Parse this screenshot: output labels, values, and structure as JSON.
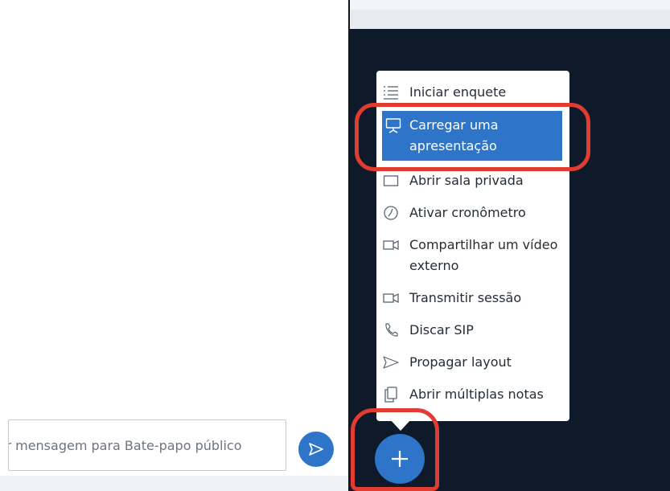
{
  "chat": {
    "input_placeholder": "ir mensagem para Bate-papo público",
    "send_icon": "send-icon"
  },
  "actions_menu": {
    "items": [
      {
        "label": "Iniciar enquete",
        "icon": "poll-list-icon",
        "highlighted": false
      },
      {
        "label": "Carregar uma apresentação",
        "icon": "presentation-icon",
        "highlighted": true
      },
      {
        "label": "Abrir sala privada",
        "icon": "breakout-room-icon",
        "highlighted": false
      },
      {
        "label": "Ativar cronômetro",
        "icon": "timer-icon",
        "highlighted": false
      },
      {
        "label": "Compartilhar um vídeo externo",
        "icon": "video-camera-icon",
        "highlighted": false
      },
      {
        "label": "Transmitir sessão",
        "icon": "video-camera-icon",
        "highlighted": false
      },
      {
        "label": "Discar SIP",
        "icon": "phone-icon",
        "highlighted": false
      },
      {
        "label": "Propagar layout",
        "icon": "send-arrow-icon",
        "highlighted": false
      },
      {
        "label": "Abrir múltiplas notas",
        "icon": "notes-icon",
        "highlighted": false
      }
    ]
  },
  "actions_button": {
    "icon": "plus-icon"
  },
  "colors": {
    "accent": "#2e75c9",
    "presentation_background": "#0e1a2a",
    "annotation_red": "#e23b30"
  }
}
